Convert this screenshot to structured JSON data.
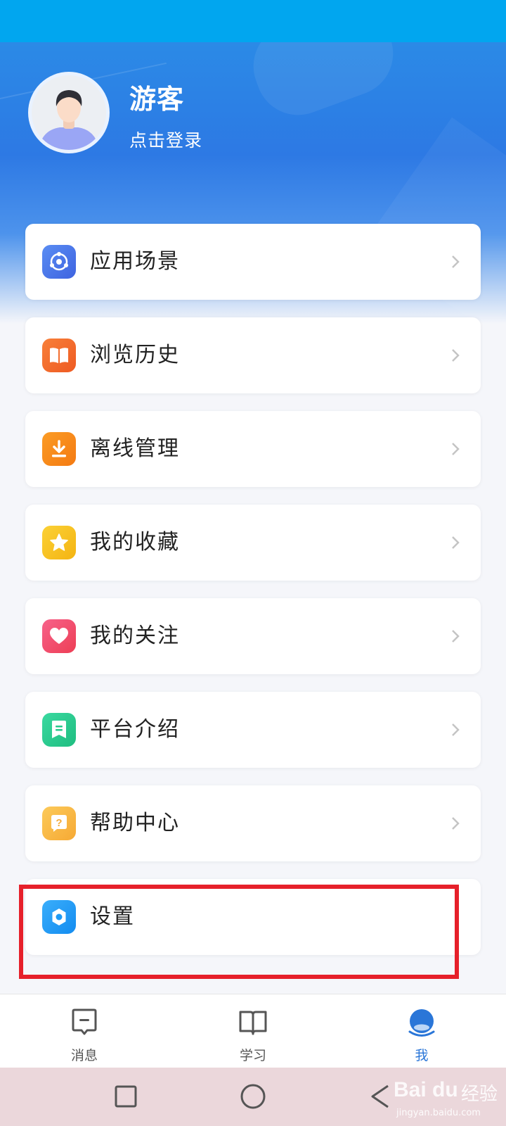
{
  "profile": {
    "username": "游客",
    "login_label": "点击登录"
  },
  "menu": [
    {
      "label": "应用场景",
      "icon": "app-scene-icon",
      "color": "#4a7cf0"
    },
    {
      "label": "浏览历史",
      "icon": "book-icon",
      "color": "#f36a2c"
    },
    {
      "label": "离线管理",
      "icon": "download-icon",
      "color": "#f7891c"
    },
    {
      "label": "我的收藏",
      "icon": "star-icon",
      "color": "#f6c222"
    },
    {
      "label": "我的关注",
      "icon": "heart-icon",
      "color": "#f2506e"
    },
    {
      "label": "平台介绍",
      "icon": "document-icon",
      "color": "#28c98e"
    },
    {
      "label": "帮助中心",
      "icon": "help-icon",
      "color": "#f8b940"
    },
    {
      "label": "设置",
      "icon": "gear-icon",
      "color": "#1e9af5"
    }
  ],
  "tabs": [
    {
      "label": "消息",
      "icon": "message-icon",
      "active": false
    },
    {
      "label": "学习",
      "icon": "book-open-icon",
      "active": false
    },
    {
      "label": "我",
      "icon": "profile-icon",
      "active": true
    }
  ],
  "watermark": {
    "brand": "Bai du",
    "sub": "经验",
    "url": "jingyan.baidu.com"
  },
  "colors": {
    "status_bar": "#01a6ef",
    "header_blue": "#2d79e4",
    "active_tab": "#2a76d8",
    "highlight": "#e6202a"
  }
}
